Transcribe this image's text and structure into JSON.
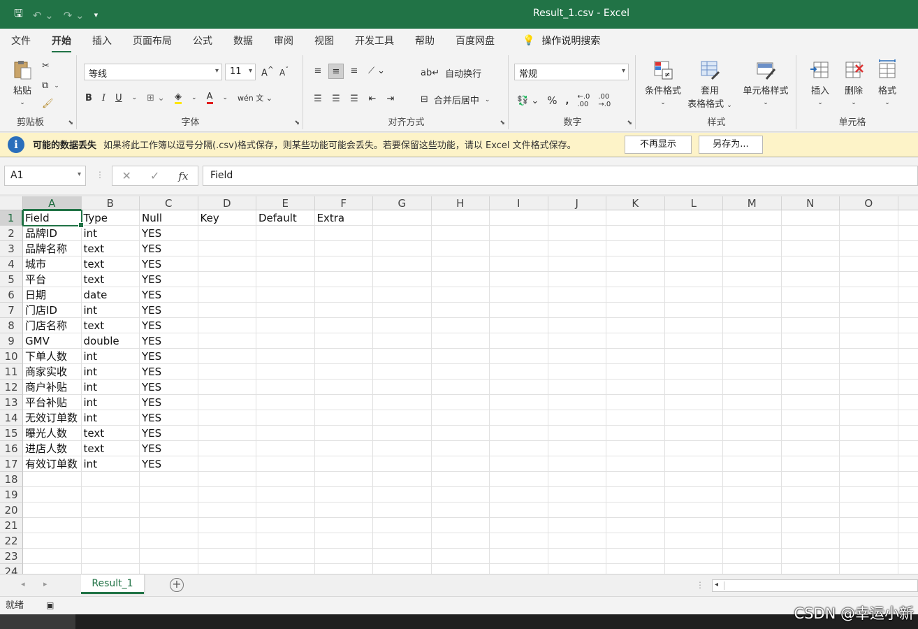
{
  "window": {
    "title": "Result_1.csv  -  Excel"
  },
  "tabs": [
    {
      "label": "文件",
      "active": false
    },
    {
      "label": "开始",
      "active": true
    },
    {
      "label": "插入",
      "active": false
    },
    {
      "label": "页面布局",
      "active": false
    },
    {
      "label": "公式",
      "active": false
    },
    {
      "label": "数据",
      "active": false
    },
    {
      "label": "审阅",
      "active": false
    },
    {
      "label": "视图",
      "active": false
    },
    {
      "label": "开发工具",
      "active": false
    },
    {
      "label": "帮助",
      "active": false
    },
    {
      "label": "百度网盘",
      "active": false
    }
  ],
  "tell_me": "操作说明搜索",
  "ribbon": {
    "clipboard": {
      "paste": "粘贴",
      "label": "剪贴板"
    },
    "font": {
      "name": "等线",
      "size": "11",
      "label": "字体",
      "bold": "B",
      "italic": "I",
      "underline": "U"
    },
    "alignment": {
      "wrap": "自动换行",
      "merge": "合并后居中",
      "label": "对齐方式"
    },
    "number": {
      "format": "常规",
      "percent": "%",
      "comma": ",",
      "label": "数字"
    },
    "styles": {
      "conditional": "条件格式",
      "table": "套用",
      "table2": "表格格式",
      "cell": "单元格样式",
      "label": "样式"
    },
    "cells": {
      "insert": "插入",
      "delete": "删除",
      "format": "格式",
      "label": "单元格"
    }
  },
  "infobar": {
    "title": "可能的数据丢失",
    "message": "如果将此工作簿以逗号分隔(.csv)格式保存，则某些功能可能会丢失。若要保留这些功能，请以 Excel 文件格式保存。",
    "dont_show": "不再显示",
    "save_as": "另存为..."
  },
  "formula_bar": {
    "name_box": "A1",
    "value": "Field"
  },
  "columns": [
    "A",
    "B",
    "C",
    "D",
    "E",
    "F",
    "G",
    "H",
    "I",
    "J",
    "K",
    "L",
    "M",
    "N",
    "O"
  ],
  "rows": [
    [
      "Field",
      "Type",
      "Null",
      "Key",
      "Default",
      "Extra"
    ],
    [
      "品牌ID",
      "int",
      "YES"
    ],
    [
      "品牌名称",
      "text",
      "YES"
    ],
    [
      "城市",
      "text",
      "YES"
    ],
    [
      "平台",
      "text",
      "YES"
    ],
    [
      "日期",
      "date",
      "YES"
    ],
    [
      "门店ID",
      "int",
      "YES"
    ],
    [
      "门店名称",
      "text",
      "YES"
    ],
    [
      "GMV",
      "double",
      "YES"
    ],
    [
      "下单人数",
      "int",
      "YES"
    ],
    [
      "商家实收",
      "int",
      "YES"
    ],
    [
      "商户补贴",
      "int",
      "YES"
    ],
    [
      "平台补贴",
      "int",
      "YES"
    ],
    [
      "无效订单数",
      "int",
      "YES"
    ],
    [
      "曝光人数",
      "text",
      "YES"
    ],
    [
      "进店人数",
      "text",
      "YES"
    ],
    [
      "有效订单数",
      "int",
      "YES"
    ],
    [],
    [],
    [],
    [],
    [],
    [],
    []
  ],
  "row_numbers": [
    "1",
    "2",
    "3",
    "4",
    "5",
    "6",
    "7",
    "8",
    "9",
    "10",
    "11",
    "12",
    "13",
    "14",
    "15",
    "16",
    "17",
    "18",
    "19",
    "20",
    "21",
    "22",
    "23",
    "24"
  ],
  "sheet_tabs": [
    "Result_1"
  ],
  "status": {
    "ready": "就绪"
  },
  "watermark": "CSDN @幸运小新",
  "colors": {
    "excel_green": "#217346",
    "info_bg": "#fdf3c8",
    "info_icon": "#2a6ebb"
  }
}
